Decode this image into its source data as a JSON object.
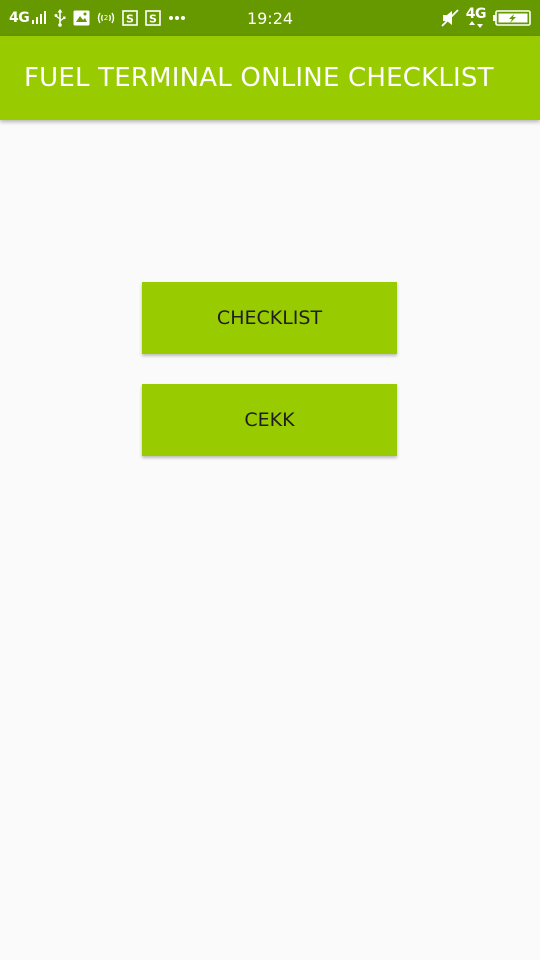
{
  "status_bar": {
    "network_left": "4G",
    "time": "19:24",
    "network_right": "4G",
    "icons_left": [
      "signal-icon",
      "usb-icon",
      "image-icon",
      "wifi-calling-icon",
      "s-app-icon",
      "s-app-icon",
      "more-dots-icon"
    ],
    "icons_right": [
      "mute-icon",
      "battery-charging-icon"
    ]
  },
  "app_bar": {
    "title": "FUEL TERMINAL ONLINE CHECKLIST"
  },
  "main": {
    "checklist_label": "CHECKLIST",
    "cekk_label": "CEKK"
  },
  "colors": {
    "status_bar": "#669900",
    "app_bar": "#99cc00",
    "button": "#99cc00",
    "background": "#fafafa"
  }
}
